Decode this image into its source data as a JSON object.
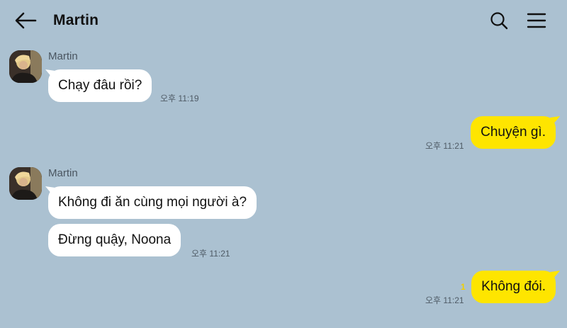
{
  "header": {
    "title": "Martin",
    "back_icon": "arrow-left-icon",
    "search_icon": "search-icon",
    "menu_icon": "hamburger-menu-icon"
  },
  "colors": {
    "background": "#abc1d1",
    "incoming_bubble": "#ffffff",
    "outgoing_bubble": "#fee500",
    "unread_count": "#f2d000"
  },
  "messages": [
    {
      "direction": "in",
      "sender": "Martin",
      "text": "Chạy đâu rồi?",
      "time": "오후 11:19"
    },
    {
      "direction": "out",
      "text": "Chuyện gì.",
      "time": "오후 11:21"
    },
    {
      "direction": "in",
      "sender": "Martin",
      "text": "Không đi ăn cùng mọi người à?"
    },
    {
      "direction": "in",
      "text": "Đừng quậy, Noona",
      "time": "오후 11:21"
    },
    {
      "direction": "out",
      "text": "Không đói.",
      "time": "오후 11:21",
      "unread": "1"
    }
  ]
}
